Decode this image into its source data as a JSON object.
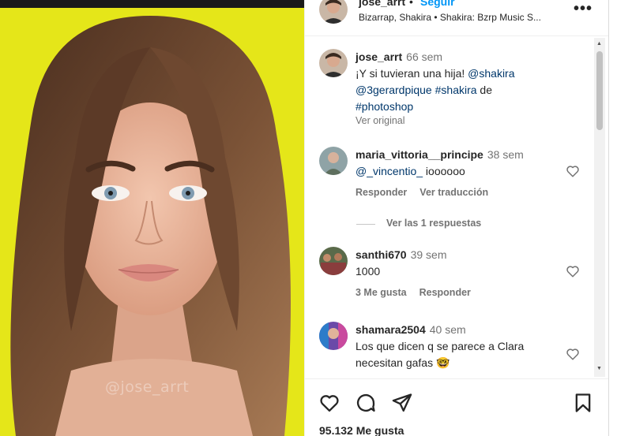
{
  "media": {
    "watermark": "@jose_arrt",
    "colors": {
      "background": "#e5e619",
      "hair": "#6b4630",
      "skin": "#e6b59c"
    }
  },
  "post_header": {
    "username": "jose_arrt",
    "separator": "•",
    "follow_label": "Seguir",
    "audio_line": "Bizarrap, Shakira • Shakira: Bzrp Music S...",
    "more_icon": "more-horizontal-icon"
  },
  "caption": {
    "username": "jose_arrt",
    "time": "66 sem",
    "text_plain": "¡Y si tuvieran una hija! ",
    "mention_1": "@shakira",
    "mention_2": "@3gerardpique",
    "hashtag_1": "#shakira",
    "text_de": " de",
    "hashtag_2": "#photoshop",
    "see_original": "Ver original"
  },
  "comments": [
    {
      "username": "maria_vittoria__principe",
      "time": "38 sem",
      "mention": "@_vincentio_",
      "text": " ioooooo",
      "actions": [
        "Responder",
        "Ver traducción"
      ],
      "replies_label": "Ver las 1 respuestas"
    },
    {
      "username": "santhi670",
      "time": "39 sem",
      "text": "1000",
      "likes": "3 Me gusta",
      "reply": "Responder"
    },
    {
      "username": "shamara2504",
      "time": "40 sem",
      "text_line1": "Los que dicen q se parece a Clara",
      "text_line2": "necesitan gafas 🤓"
    }
  ],
  "action_bar": {
    "icons": [
      "heart-icon",
      "comment-icon",
      "share-icon",
      "bookmark-icon"
    ],
    "likes_count": "95.132 Me gusta"
  },
  "accent_colors": {
    "link": "#00376b",
    "follow": "#0095f6",
    "secondary_text": "#737373"
  }
}
